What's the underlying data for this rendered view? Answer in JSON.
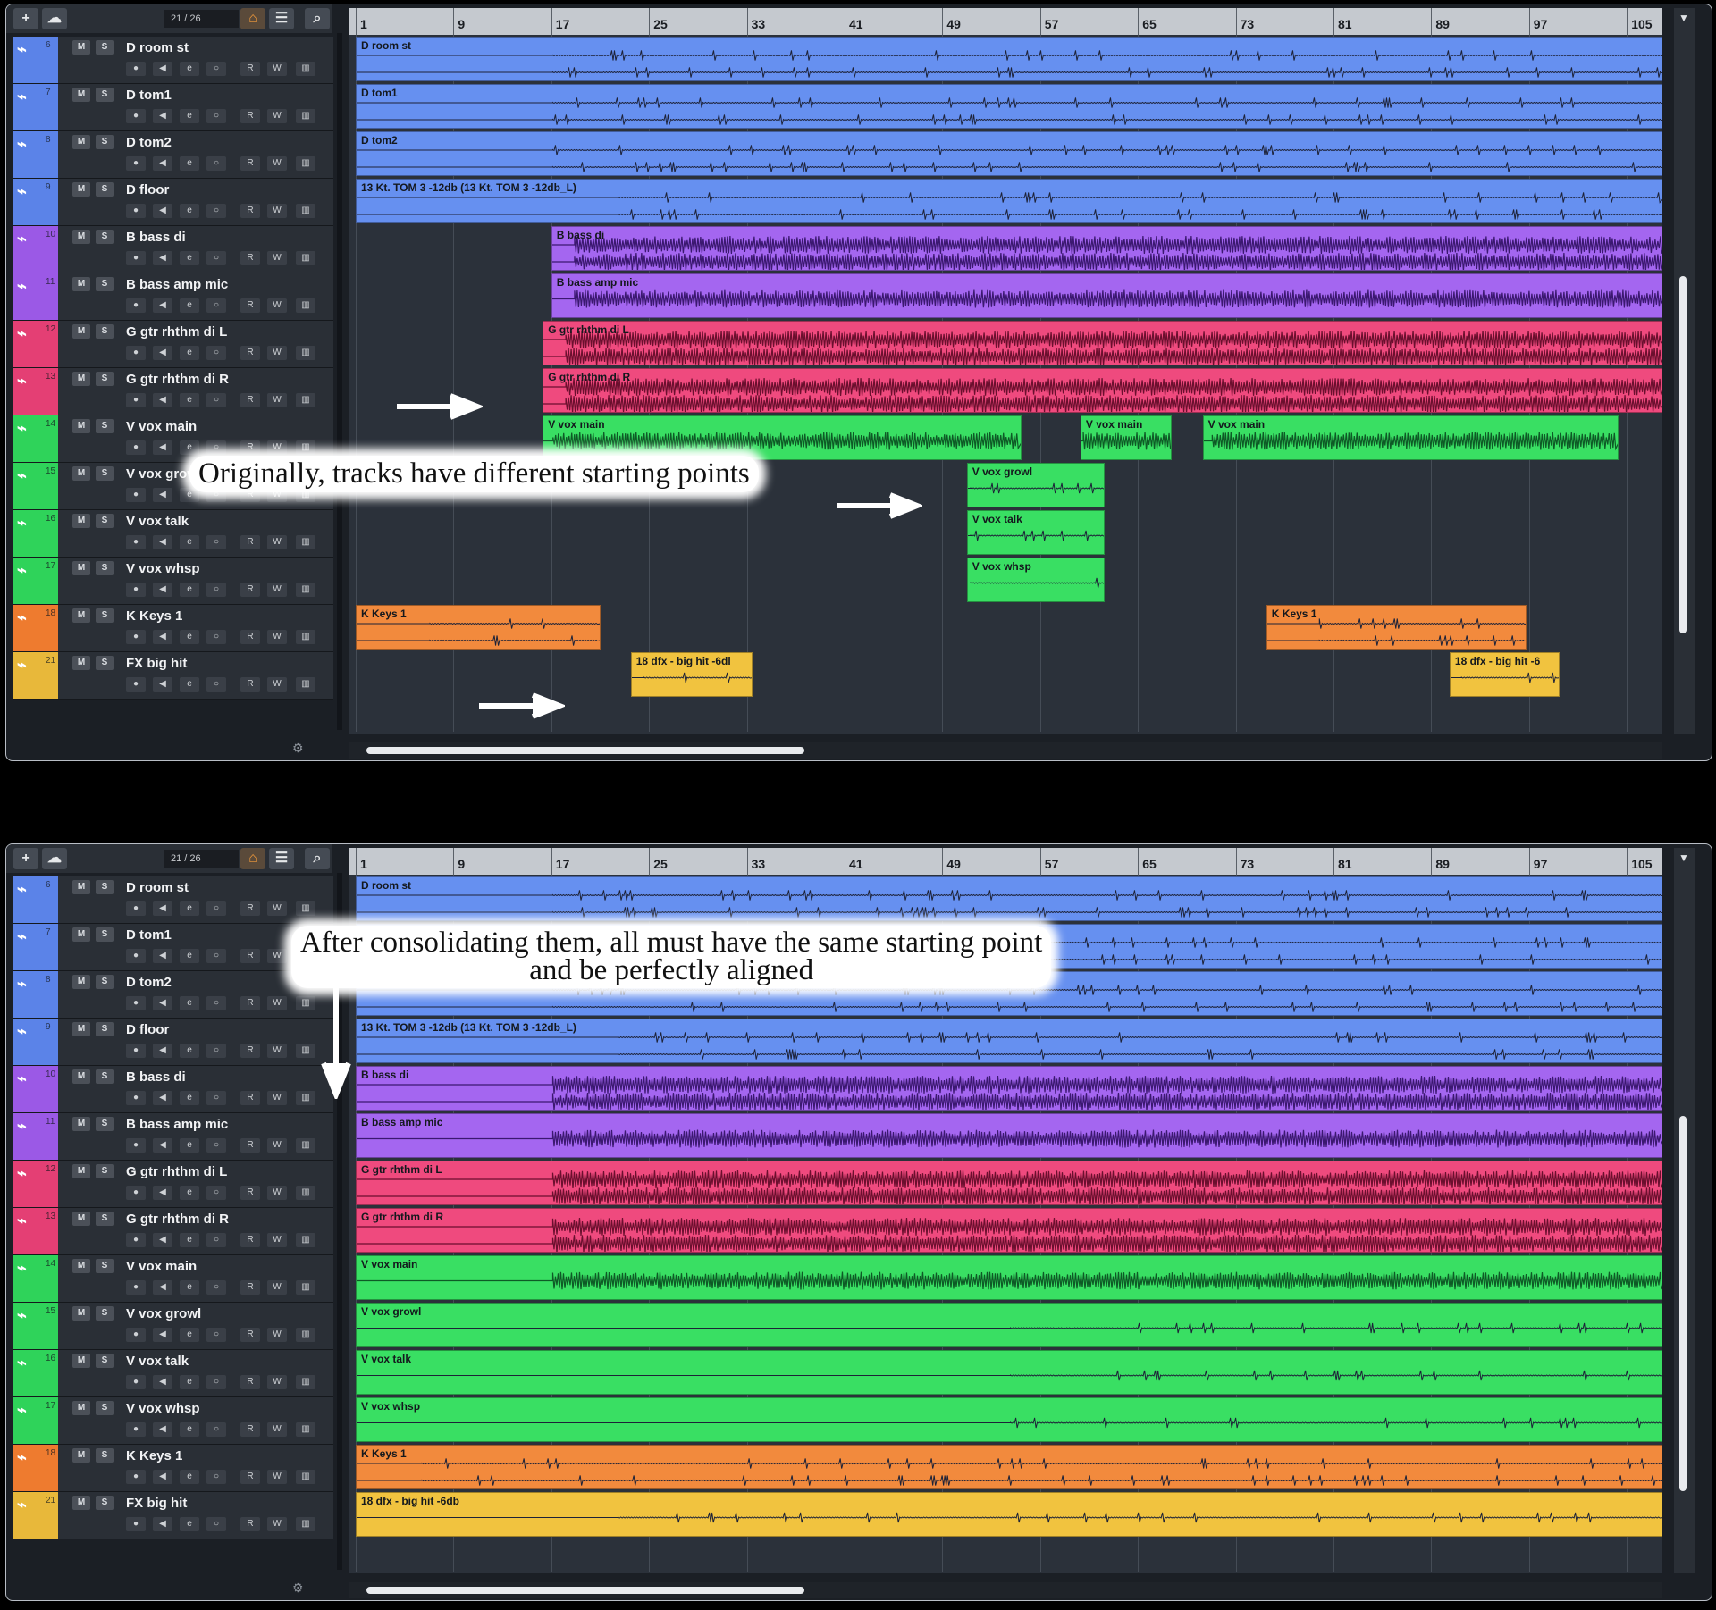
{
  "toolbar": {
    "counter": "21 / 26"
  },
  "ruler": [
    "1",
    "9",
    "17",
    "25",
    "33",
    "41",
    "49",
    "57",
    "65",
    "73",
    "81",
    "89",
    "97",
    "105"
  ],
  "tracks": [
    {
      "num": "6",
      "name": "D room st",
      "color": "#5b83e8",
      "clip": "#6690f0"
    },
    {
      "num": "7",
      "name": "D tom1",
      "color": "#5b83e8",
      "clip": "#6690f0"
    },
    {
      "num": "8",
      "name": "D tom2",
      "color": "#5b83e8",
      "clip": "#6690f0"
    },
    {
      "num": "9",
      "name": "D floor",
      "color": "#5b83e8",
      "clip": "#6690f0"
    },
    {
      "num": "10",
      "name": "B bass di",
      "color": "#9b59e6",
      "clip": "#a466f0"
    },
    {
      "num": "11",
      "name": "B bass amp mic",
      "color": "#9b59e6",
      "clip": "#a466f0"
    },
    {
      "num": "12",
      "name": "G gtr rhthm di L",
      "color": "#e43f74",
      "clip": "#ef4a7e"
    },
    {
      "num": "13",
      "name": "G gtr rhthm di R",
      "color": "#e43f74",
      "clip": "#ef4a7e"
    },
    {
      "num": "14",
      "name": "V vox main",
      "color": "#2fd35a",
      "clip": "#39df63"
    },
    {
      "num": "15",
      "name": "V vox growl",
      "color": "#2fd35a",
      "clip": "#39df63"
    },
    {
      "num": "16",
      "name": "V vox talk",
      "color": "#2fd35a",
      "clip": "#39df63"
    },
    {
      "num": "17",
      "name": "V vox whsp",
      "color": "#2fd35a",
      "clip": "#39df63"
    },
    {
      "num": "18",
      "name": "K Keys 1",
      "color": "#ee7b2f",
      "clip": "#f28a3d"
    },
    {
      "num": "21",
      "name": "FX big hit",
      "color": "#e8b83a",
      "clip": "#f1c33f"
    }
  ],
  "clip_labels": {
    "d_room": "D room st",
    "d_tom1": "D tom1",
    "d_tom2": "D tom2",
    "d_floor": "13 Kt. TOM 3 -12db (13 Kt. TOM 3 -12db_L)",
    "b_bass": "B bass di",
    "b_amp": "B bass amp mic",
    "g_l": "G gtr rhthm di L",
    "g_r": "G gtr rhthm di R",
    "v_main": "V vox main",
    "v_growl": "V vox growl",
    "v_talk": "V vox talk",
    "v_whsp": "V vox whsp",
    "keys": "K Keys 1",
    "fx": "18 dfx - big hit -6db",
    "fx_cut1": "18 dfx - big hit -6dl",
    "fx_cut2": "18 dfx - big hit -6"
  },
  "callouts": {
    "top": "Originally, tracks have different starting points",
    "bottom_line1": "After consolidating them, all must have the same starting point",
    "bottom_line2": "and be perfectly aligned"
  },
  "controls": {
    "mute": "M",
    "solo": "S",
    "read": "R",
    "write": "W"
  }
}
